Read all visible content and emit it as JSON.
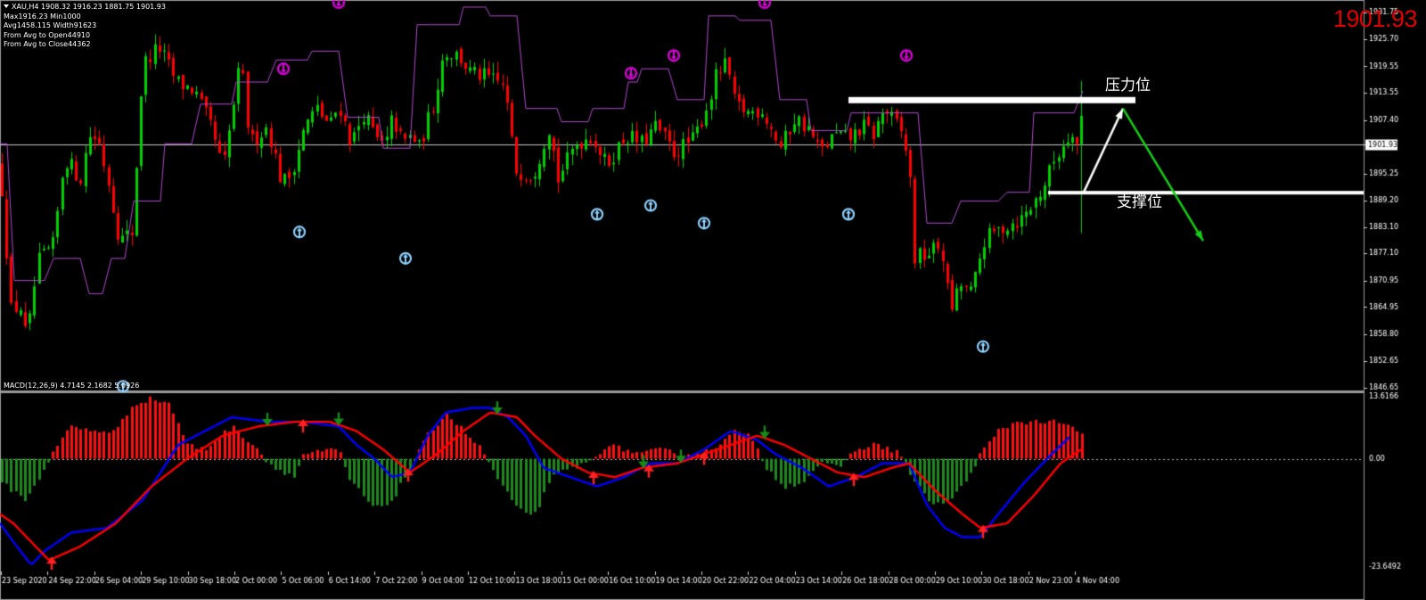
{
  "header": {
    "symbol": "XAU,H4",
    "ohlc": "1908.32 1916.23 1881.75 1901.93",
    "line2": "Max1916.23 Min1000",
    "line3": "Avg1458.115 Width91623",
    "line4": "From Avg to Open44910",
    "line5": "From Avg to Close44362"
  },
  "current_price": "1901.93",
  "annotations": {
    "resistance": "压力位",
    "support": "支撑位"
  },
  "macd": {
    "label": "MACD(12,26,9) 4.7145 2.1682 5.0926",
    "axis_top": "13.6166",
    "axis_zero": "0.00",
    "axis_bottom": "-23.6492"
  },
  "colors": {
    "background": "#000000",
    "bull_candle": "#00d000",
    "bear_candle": "#ff0000",
    "envelope": "#b04ad0",
    "macd_line": "#0000ff",
    "signal_line": "#ff0000",
    "price_label": "#e00000"
  },
  "chart_data": [
    {
      "type": "candlestick",
      "symbol": "XAU",
      "timeframe": "H4",
      "ylim": [
        1846.65,
        1934.0
      ],
      "y_ticks": [
        "1931.75",
        "1925.70",
        "1919.55",
        "1913.55",
        "1907.40",
        "1901.93",
        "1895.25",
        "1889.20",
        "1883.10",
        "1877.10",
        "1870.95",
        "1864.95",
        "1858.80",
        "1852.65",
        "1846.65"
      ],
      "x_ticks": [
        "23 Sep 2020",
        "24 Sep 22:00",
        "26 Sep 04:00",
        "29 Sep 10:00",
        "30 Sep 18:00",
        "2 Oct 00:00",
        "5 Oct 06:00",
        "6 Oct 14:00",
        "7 Oct 22:00",
        "9 Oct 04:00",
        "12 Oct 10:00",
        "13 Oct 18:00",
        "15 Oct 00:00",
        "16 Oct 10:00",
        "19 Oct 14:00",
        "20 Oct 22:00",
        "22 Oct 04:00",
        "23 Oct 14:00",
        "26 Oct 18:00",
        "28 Oct 00:00",
        "29 Oct 10:00",
        "30 Oct 18:00",
        "2 Nov 23:00",
        "4 Nov 04:00"
      ],
      "anchor_path": [
        [
          0,
          1897
        ],
        [
          14,
          1860
        ],
        [
          20,
          1868
        ],
        [
          30,
          1857
        ],
        [
          42,
          1875
        ],
        [
          60,
          1879
        ],
        [
          72,
          1899
        ],
        [
          90,
          1894
        ],
        [
          100,
          1904
        ],
        [
          110,
          1903
        ],
        [
          122,
          1893
        ],
        [
          134,
          1880
        ],
        [
          148,
          1882
        ],
        [
          160,
          1920
        ],
        [
          178,
          1924
        ],
        [
          198,
          1916
        ],
        [
          218,
          1914
        ],
        [
          238,
          1905
        ],
        [
          250,
          1896
        ],
        [
          270,
          1921
        ],
        [
          280,
          1902
        ],
        [
          300,
          1906
        ],
        [
          316,
          1893
        ],
        [
          326,
          1895
        ],
        [
          342,
          1906
        ],
        [
          355,
          1910
        ],
        [
          370,
          1906
        ],
        [
          380,
          1911
        ],
        [
          394,
          1902
        ],
        [
          408,
          1909
        ],
        [
          422,
          1903
        ],
        [
          432,
          1901
        ],
        [
          440,
          1908
        ],
        [
          452,
          1902
        ],
        [
          462,
          1904
        ],
        [
          470,
          1901
        ],
        [
          486,
          1911
        ],
        [
          498,
          1923
        ],
        [
          514,
          1922
        ],
        [
          528,
          1918
        ],
        [
          546,
          1917
        ],
        [
          566,
          1915
        ],
        [
          578,
          1896
        ],
        [
          598,
          1895
        ],
        [
          616,
          1906
        ],
        [
          626,
          1894
        ],
        [
          646,
          1902
        ],
        [
          664,
          1904
        ],
        [
          680,
          1897
        ],
        [
          702,
          1904
        ],
        [
          720,
          1902
        ],
        [
          736,
          1906
        ],
        [
          756,
          1900
        ],
        [
          778,
          1903
        ],
        [
          796,
          1912
        ],
        [
          804,
          1918
        ],
        [
          816,
          1920
        ],
        [
          824,
          1911
        ],
        [
          840,
          1909
        ],
        [
          854,
          1910
        ],
        [
          864,
          1906
        ],
        [
          876,
          1901
        ],
        [
          892,
          1908
        ],
        [
          908,
          1905
        ],
        [
          920,
          1900
        ],
        [
          936,
          1904
        ],
        [
          952,
          1903
        ],
        [
          968,
          1906
        ],
        [
          980,
          1904
        ],
        [
          992,
          1910
        ],
        [
          1010,
          1905
        ],
        [
          1020,
          1898
        ],
        [
          1026,
          1876
        ],
        [
          1040,
          1877
        ],
        [
          1056,
          1879
        ],
        [
          1066,
          1864
        ],
        [
          1078,
          1870
        ],
        [
          1090,
          1868
        ],
        [
          1104,
          1880
        ],
        [
          1116,
          1882
        ],
        [
          1134,
          1884
        ],
        [
          1146,
          1885
        ],
        [
          1158,
          1888
        ],
        [
          1170,
          1892
        ],
        [
          1182,
          1898
        ],
        [
          1196,
          1903
        ],
        [
          1208,
          1907
        ],
        [
          1213,
          1901.93
        ]
      ],
      "envelope_upper_steps": [
        [
          0,
          1902
        ],
        [
          8,
          1902
        ],
        [
          16,
          1871
        ],
        [
          50,
          1871
        ],
        [
          60,
          1876
        ],
        [
          90,
          1876
        ],
        [
          100,
          1868
        ],
        [
          115,
          1868
        ],
        [
          125,
          1876
        ],
        [
          140,
          1876
        ],
        [
          150,
          1889
        ],
        [
          180,
          1889
        ],
        [
          185,
          1902
        ],
        [
          215,
          1902
        ],
        [
          225,
          1911
        ],
        [
          260,
          1911
        ],
        [
          265,
          1916
        ],
        [
          300,
          1916
        ],
        [
          310,
          1921
        ],
        [
          345,
          1921
        ],
        [
          350,
          1923
        ],
        [
          380,
          1923
        ],
        [
          390,
          1908
        ],
        [
          425,
          1908
        ],
        [
          430,
          1901
        ],
        [
          460,
          1901
        ],
        [
          468,
          1929
        ],
        [
          515,
          1929
        ],
        [
          520,
          1933
        ],
        [
          545,
          1933
        ],
        [
          550,
          1931
        ],
        [
          580,
          1931
        ],
        [
          590,
          1910
        ],
        [
          625,
          1910
        ],
        [
          630,
          1907
        ],
        [
          660,
          1907
        ],
        [
          665,
          1910
        ],
        [
          700,
          1910
        ],
        [
          705,
          1916
        ],
        [
          715,
          1916
        ],
        [
          720,
          1919
        ],
        [
          750,
          1919
        ],
        [
          760,
          1912
        ],
        [
          790,
          1912
        ],
        [
          795,
          1931
        ],
        [
          825,
          1931
        ],
        [
          830,
          1930
        ],
        [
          865,
          1930
        ],
        [
          875,
          1912
        ],
        [
          905,
          1912
        ],
        [
          910,
          1905
        ],
        [
          950,
          1905
        ],
        [
          955,
          1909
        ],
        [
          1030,
          1909
        ],
        [
          1040,
          1884
        ],
        [
          1068,
          1884
        ],
        [
          1078,
          1889
        ],
        [
          1120,
          1889
        ],
        [
          1130,
          1891
        ],
        [
          1155,
          1891
        ],
        [
          1160,
          1909
        ],
        [
          1205,
          1909
        ],
        [
          1215,
          1914
        ]
      ],
      "arrows_down": [
        [
          380,
          1934
        ],
        [
          318,
          1919
        ],
        [
          708,
          1918
        ],
        [
          756,
          1922
        ],
        [
          858,
          1934
        ],
        [
          1017,
          1922
        ],
        [
          556,
          1939
        ],
        [
          1222,
          1939
        ]
      ],
      "arrows_up": [
        [
          336,
          1882
        ],
        [
          455,
          1876
        ],
        [
          670,
          1886
        ],
        [
          730,
          1888
        ],
        [
          790,
          1884
        ],
        [
          952,
          1886
        ],
        [
          1103,
          1856
        ],
        [
          138,
          1847
        ]
      ],
      "resistance_line": 1911.8,
      "support_line": 1890.9,
      "projection": {
        "white_start": [
          1215,
          1890.6
        ],
        "white_end": [
          1260,
          1910
        ],
        "green_end": [
          1350,
          1880
        ]
      }
    },
    {
      "type": "macd",
      "params": [
        12,
        26,
        9
      ],
      "values": {
        "macd": 4.7145,
        "signal": 2.1682,
        "histogram": 5.0926
      },
      "ylim": [
        -23.6492,
        13.6166
      ],
      "histogram_anchors": [
        [
          0,
          -5
        ],
        [
          30,
          -9
        ],
        [
          50,
          -2
        ],
        [
          60,
          2
        ],
        [
          80,
          7
        ],
        [
          100,
          6
        ],
        [
          130,
          6
        ],
        [
          150,
          12
        ],
        [
          170,
          13
        ],
        [
          190,
          12
        ],
        [
          210,
          3
        ],
        [
          230,
          2
        ],
        [
          260,
          7
        ],
        [
          290,
          2
        ],
        [
          300,
          -1
        ],
        [
          330,
          -4
        ],
        [
          340,
          1
        ],
        [
          380,
          2
        ],
        [
          390,
          -4
        ],
        [
          420,
          -11
        ],
        [
          440,
          -9
        ],
        [
          460,
          -2
        ],
        [
          480,
          5
        ],
        [
          500,
          10
        ],
        [
          520,
          6
        ],
        [
          540,
          2
        ],
        [
          560,
          -5
        ],
        [
          580,
          -11
        ],
        [
          600,
          -12
        ],
        [
          620,
          -4
        ],
        [
          640,
          -2
        ],
        [
          660,
          -1
        ],
        [
          680,
          3
        ],
        [
          700,
          2
        ],
        [
          720,
          1
        ],
        [
          740,
          2
        ],
        [
          760,
          1
        ],
        [
          780,
          1
        ],
        [
          800,
          2
        ],
        [
          820,
          6
        ],
        [
          840,
          5
        ],
        [
          860,
          -2
        ],
        [
          880,
          -6
        ],
        [
          900,
          -5
        ],
        [
          920,
          -1
        ],
        [
          940,
          -2
        ],
        [
          960,
          2
        ],
        [
          980,
          3
        ],
        [
          1000,
          2
        ],
        [
          1010,
          1
        ],
        [
          1020,
          -3
        ],
        [
          1040,
          -9
        ],
        [
          1060,
          -10
        ],
        [
          1080,
          -6
        ],
        [
          1100,
          1
        ],
        [
          1120,
          6
        ],
        [
          1140,
          8
        ],
        [
          1160,
          8
        ],
        [
          1180,
          8
        ],
        [
          1200,
          7
        ],
        [
          1215,
          5
        ]
      ],
      "macd_line_anchors": [
        [
          0,
          -14
        ],
        [
          15,
          -18
        ],
        [
          35,
          -23
        ],
        [
          50,
          -20
        ],
        [
          80,
          -16
        ],
        [
          120,
          -15
        ],
        [
          160,
          -9
        ],
        [
          200,
          3
        ],
        [
          230,
          6
        ],
        [
          260,
          9
        ],
        [
          300,
          8
        ],
        [
          340,
          8
        ],
        [
          380,
          7
        ],
        [
          400,
          3
        ],
        [
          420,
          0
        ],
        [
          440,
          -4
        ],
        [
          460,
          -3
        ],
        [
          480,
          5
        ],
        [
          500,
          10
        ],
        [
          530,
          11
        ],
        [
          550,
          11
        ],
        [
          570,
          9
        ],
        [
          590,
          5
        ],
        [
          610,
          -2
        ],
        [
          640,
          -4
        ],
        [
          670,
          -6
        ],
        [
          700,
          -4
        ],
        [
          730,
          -1
        ],
        [
          760,
          -1
        ],
        [
          790,
          2
        ],
        [
          820,
          6
        ],
        [
          850,
          4
        ],
        [
          870,
          1
        ],
        [
          900,
          -2
        ],
        [
          930,
          -6
        ],
        [
          960,
          -4
        ],
        [
          990,
          -1
        ],
        [
          1020,
          -1
        ],
        [
          1040,
          -10
        ],
        [
          1060,
          -15
        ],
        [
          1080,
          -17
        ],
        [
          1100,
          -17
        ],
        [
          1120,
          -12
        ],
        [
          1150,
          -5
        ],
        [
          1180,
          1
        ],
        [
          1200,
          4.7
        ]
      ],
      "signal_line_anchors": [
        [
          0,
          -12
        ],
        [
          15,
          -14
        ],
        [
          35,
          -18
        ],
        [
          55,
          -22
        ],
        [
          90,
          -19
        ],
        [
          130,
          -14
        ],
        [
          170,
          -6
        ],
        [
          210,
          0
        ],
        [
          250,
          5
        ],
        [
          290,
          7
        ],
        [
          330,
          8
        ],
        [
          370,
          8
        ],
        [
          400,
          6
        ],
        [
          430,
          2
        ],
        [
          460,
          -3
        ],
        [
          490,
          1
        ],
        [
          520,
          6
        ],
        [
          550,
          10
        ],
        [
          580,
          9
        ],
        [
          600,
          5
        ],
        [
          630,
          0
        ],
        [
          660,
          -3
        ],
        [
          690,
          -4
        ],
        [
          720,
          -2
        ],
        [
          760,
          -1
        ],
        [
          790,
          1
        ],
        [
          820,
          3
        ],
        [
          850,
          5
        ],
        [
          880,
          3
        ],
        [
          910,
          0
        ],
        [
          940,
          -3
        ],
        [
          970,
          -4
        ],
        [
          1000,
          -2
        ],
        [
          1020,
          -1
        ],
        [
          1050,
          -7
        ],
        [
          1080,
          -12
        ],
        [
          1100,
          -15
        ],
        [
          1130,
          -14
        ],
        [
          1160,
          -8
        ],
        [
          1190,
          -1
        ],
        [
          1215,
          2.2
        ]
      ],
      "signal_arrows_down": [
        300,
        380,
        558,
        722,
        764,
        858
      ],
      "signal_arrows_up": [
        58,
        340,
        458,
        666,
        728,
        790,
        958,
        1103
      ]
    }
  ]
}
